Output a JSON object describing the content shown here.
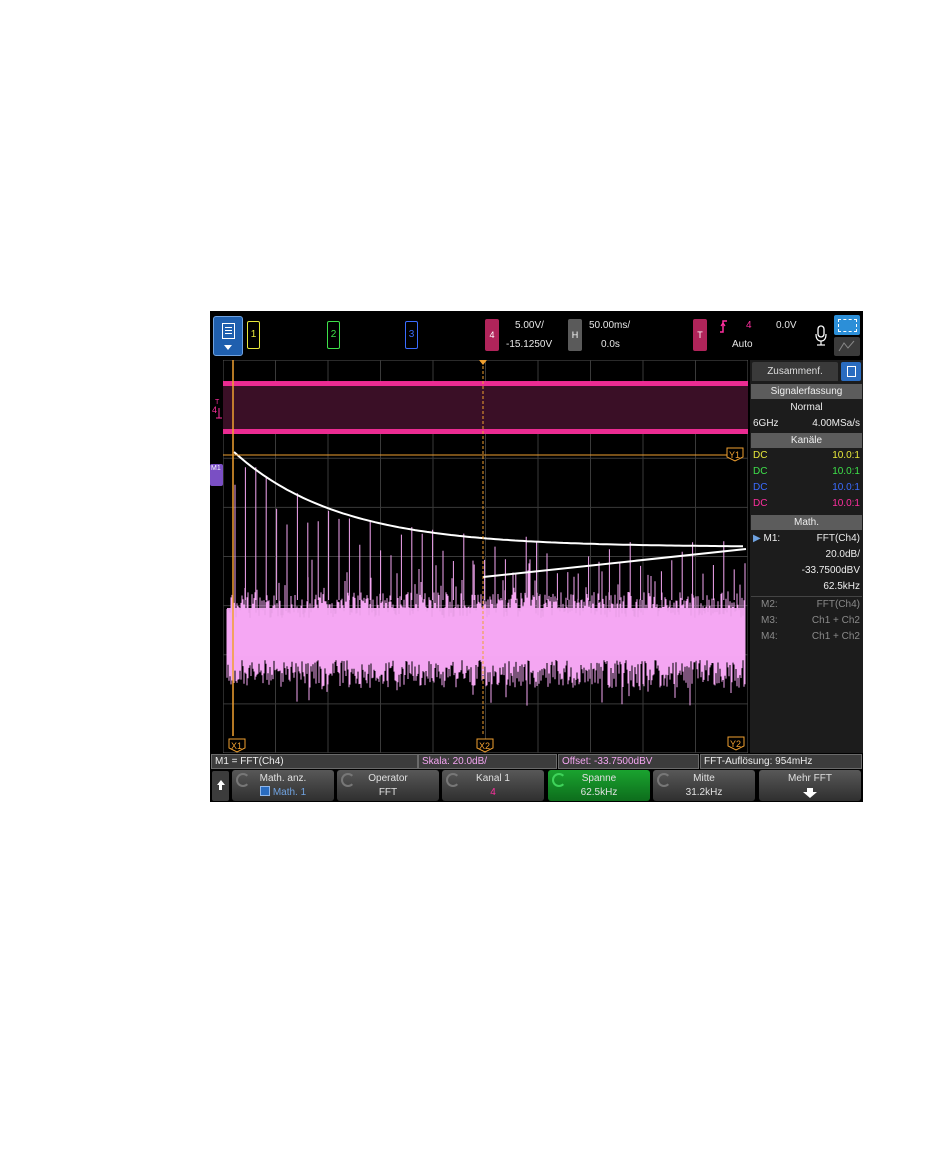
{
  "topbar": {
    "channels": [
      "1",
      "2",
      "3"
    ],
    "ch4_scale": "5.00V/",
    "ch4_offset": "-15.1250V",
    "ch4_tag": "4",
    "horiz_tag": "H",
    "horiz_scale": "50.00ms/",
    "horiz_delay": "0.0s",
    "trig_tag": "T",
    "trig_source": "4",
    "trig_level": "0.0V",
    "trig_mode": "Auto",
    "icons": [
      "menu-icon",
      "trigger-edge-icon",
      "microphone-icon",
      "zoom-select-icon",
      "measure-icon"
    ]
  },
  "graticule": {
    "markers": {
      "ch4": "4",
      "math": "M1",
      "y1": "Y1",
      "y2": "Y2",
      "x1": "X1",
      "x2": "X2"
    }
  },
  "panel": {
    "tab_label": "Zusammenf.",
    "acq_header": "Signalerfassung",
    "acq_mode": "Normal",
    "acq_bw": "6GHz",
    "acq_rate": "4.00MSa/s",
    "ch_header": "Kanäle",
    "channels": [
      {
        "coupling": "DC",
        "probe": "10.0:1",
        "color": "#e8e83a"
      },
      {
        "coupling": "DC",
        "probe": "10.0:1",
        "color": "#3ee04a"
      },
      {
        "coupling": "DC",
        "probe": "10.0:1",
        "color": "#3a6cff"
      },
      {
        "coupling": "DC",
        "probe": "10.0:1",
        "color": "#ff2f9f"
      }
    ],
    "math_header": "Math.",
    "m1_label": "M1:",
    "m1_func": "FFT(Ch4)",
    "m1_scale": "20.0dB/",
    "m1_offset": "-33.7500dBV",
    "m1_span": "62.5kHz",
    "others": [
      {
        "label": "M2:",
        "value": "FFT(Ch4)"
      },
      {
        "label": "M3:",
        "value": "Ch1 + Ch2"
      },
      {
        "label": "M4:",
        "value": "Ch1 + Ch2"
      }
    ]
  },
  "status": {
    "func": "M1 = FFT(Ch4)",
    "scale": "Skala: 20.0dB/",
    "offset": "Offset: -33.7500dBV",
    "resolution": "FFT-Auflösung: 954mHz"
  },
  "softkeys": [
    {
      "t1": "Math. anz.",
      "t2": "Math. 1"
    },
    {
      "t1": "Operator",
      "t2": "FFT"
    },
    {
      "t1": "Kanal 1",
      "t2": "4"
    },
    {
      "t1": "Spanne",
      "t2": "62.5kHz"
    },
    {
      "t1": "Mitte",
      "t2": "31.2kHz"
    },
    {
      "t1": "Mehr FFT",
      "t2": ""
    }
  ],
  "colors": {
    "ch1": "#e8e83a",
    "ch2": "#3ee04a",
    "ch3": "#3a6cff",
    "ch4": "#ff2f9f",
    "math": "#f4a6f2",
    "cursor": "#f0a030",
    "active_softkey": "#1aa32f"
  }
}
